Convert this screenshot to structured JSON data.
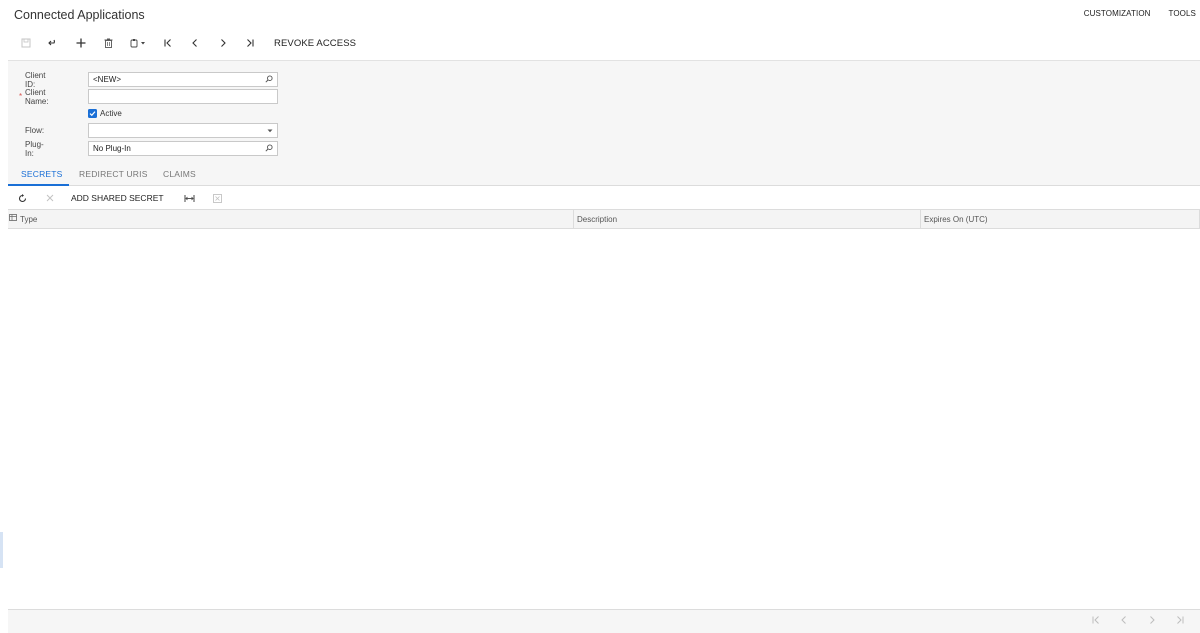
{
  "header": {
    "title": "Connected Applications",
    "links": [
      "CUSTOMIZATION",
      "TOOLS"
    ]
  },
  "toolbar": {
    "buttons": [
      {
        "icon": "save-icon",
        "enabled": false
      },
      {
        "icon": "undo-icon",
        "enabled": true
      },
      {
        "icon": "add-icon",
        "enabled": true
      },
      {
        "icon": "delete-icon",
        "enabled": true
      },
      {
        "icon": "copy-paste-icon",
        "enabled": true
      },
      {
        "icon": "first-record-icon",
        "enabled": true
      },
      {
        "icon": "previous-record-icon",
        "enabled": true
      },
      {
        "icon": "next-record-icon",
        "enabled": true
      },
      {
        "icon": "last-record-icon",
        "enabled": true
      }
    ],
    "revoke_label": "REVOKE ACCESS"
  },
  "form": {
    "client_id": {
      "label": "Client ID:",
      "value": "<NEW>"
    },
    "client_name": {
      "label": "Client Name:",
      "value": "",
      "required_mark": "*"
    },
    "active": {
      "label": "Active",
      "checked": true
    },
    "flow": {
      "label": "Flow:",
      "value": ""
    },
    "plugin": {
      "label": "Plug-In:",
      "value": "No Plug-In"
    }
  },
  "tabs": [
    {
      "label": "SECRETS",
      "active": true
    },
    {
      "label": "REDIRECT URIS",
      "active": false
    },
    {
      "label": "CLAIMS",
      "active": false
    }
  ],
  "grid_toolbar": {
    "add_label": "ADD SHARED SECRET"
  },
  "grid": {
    "columns": [
      "Type",
      "Description",
      "Expires On (UTC)"
    ],
    "rows": []
  },
  "colors": {
    "accent": "#1a6fd6",
    "required": "#d9534f"
  }
}
